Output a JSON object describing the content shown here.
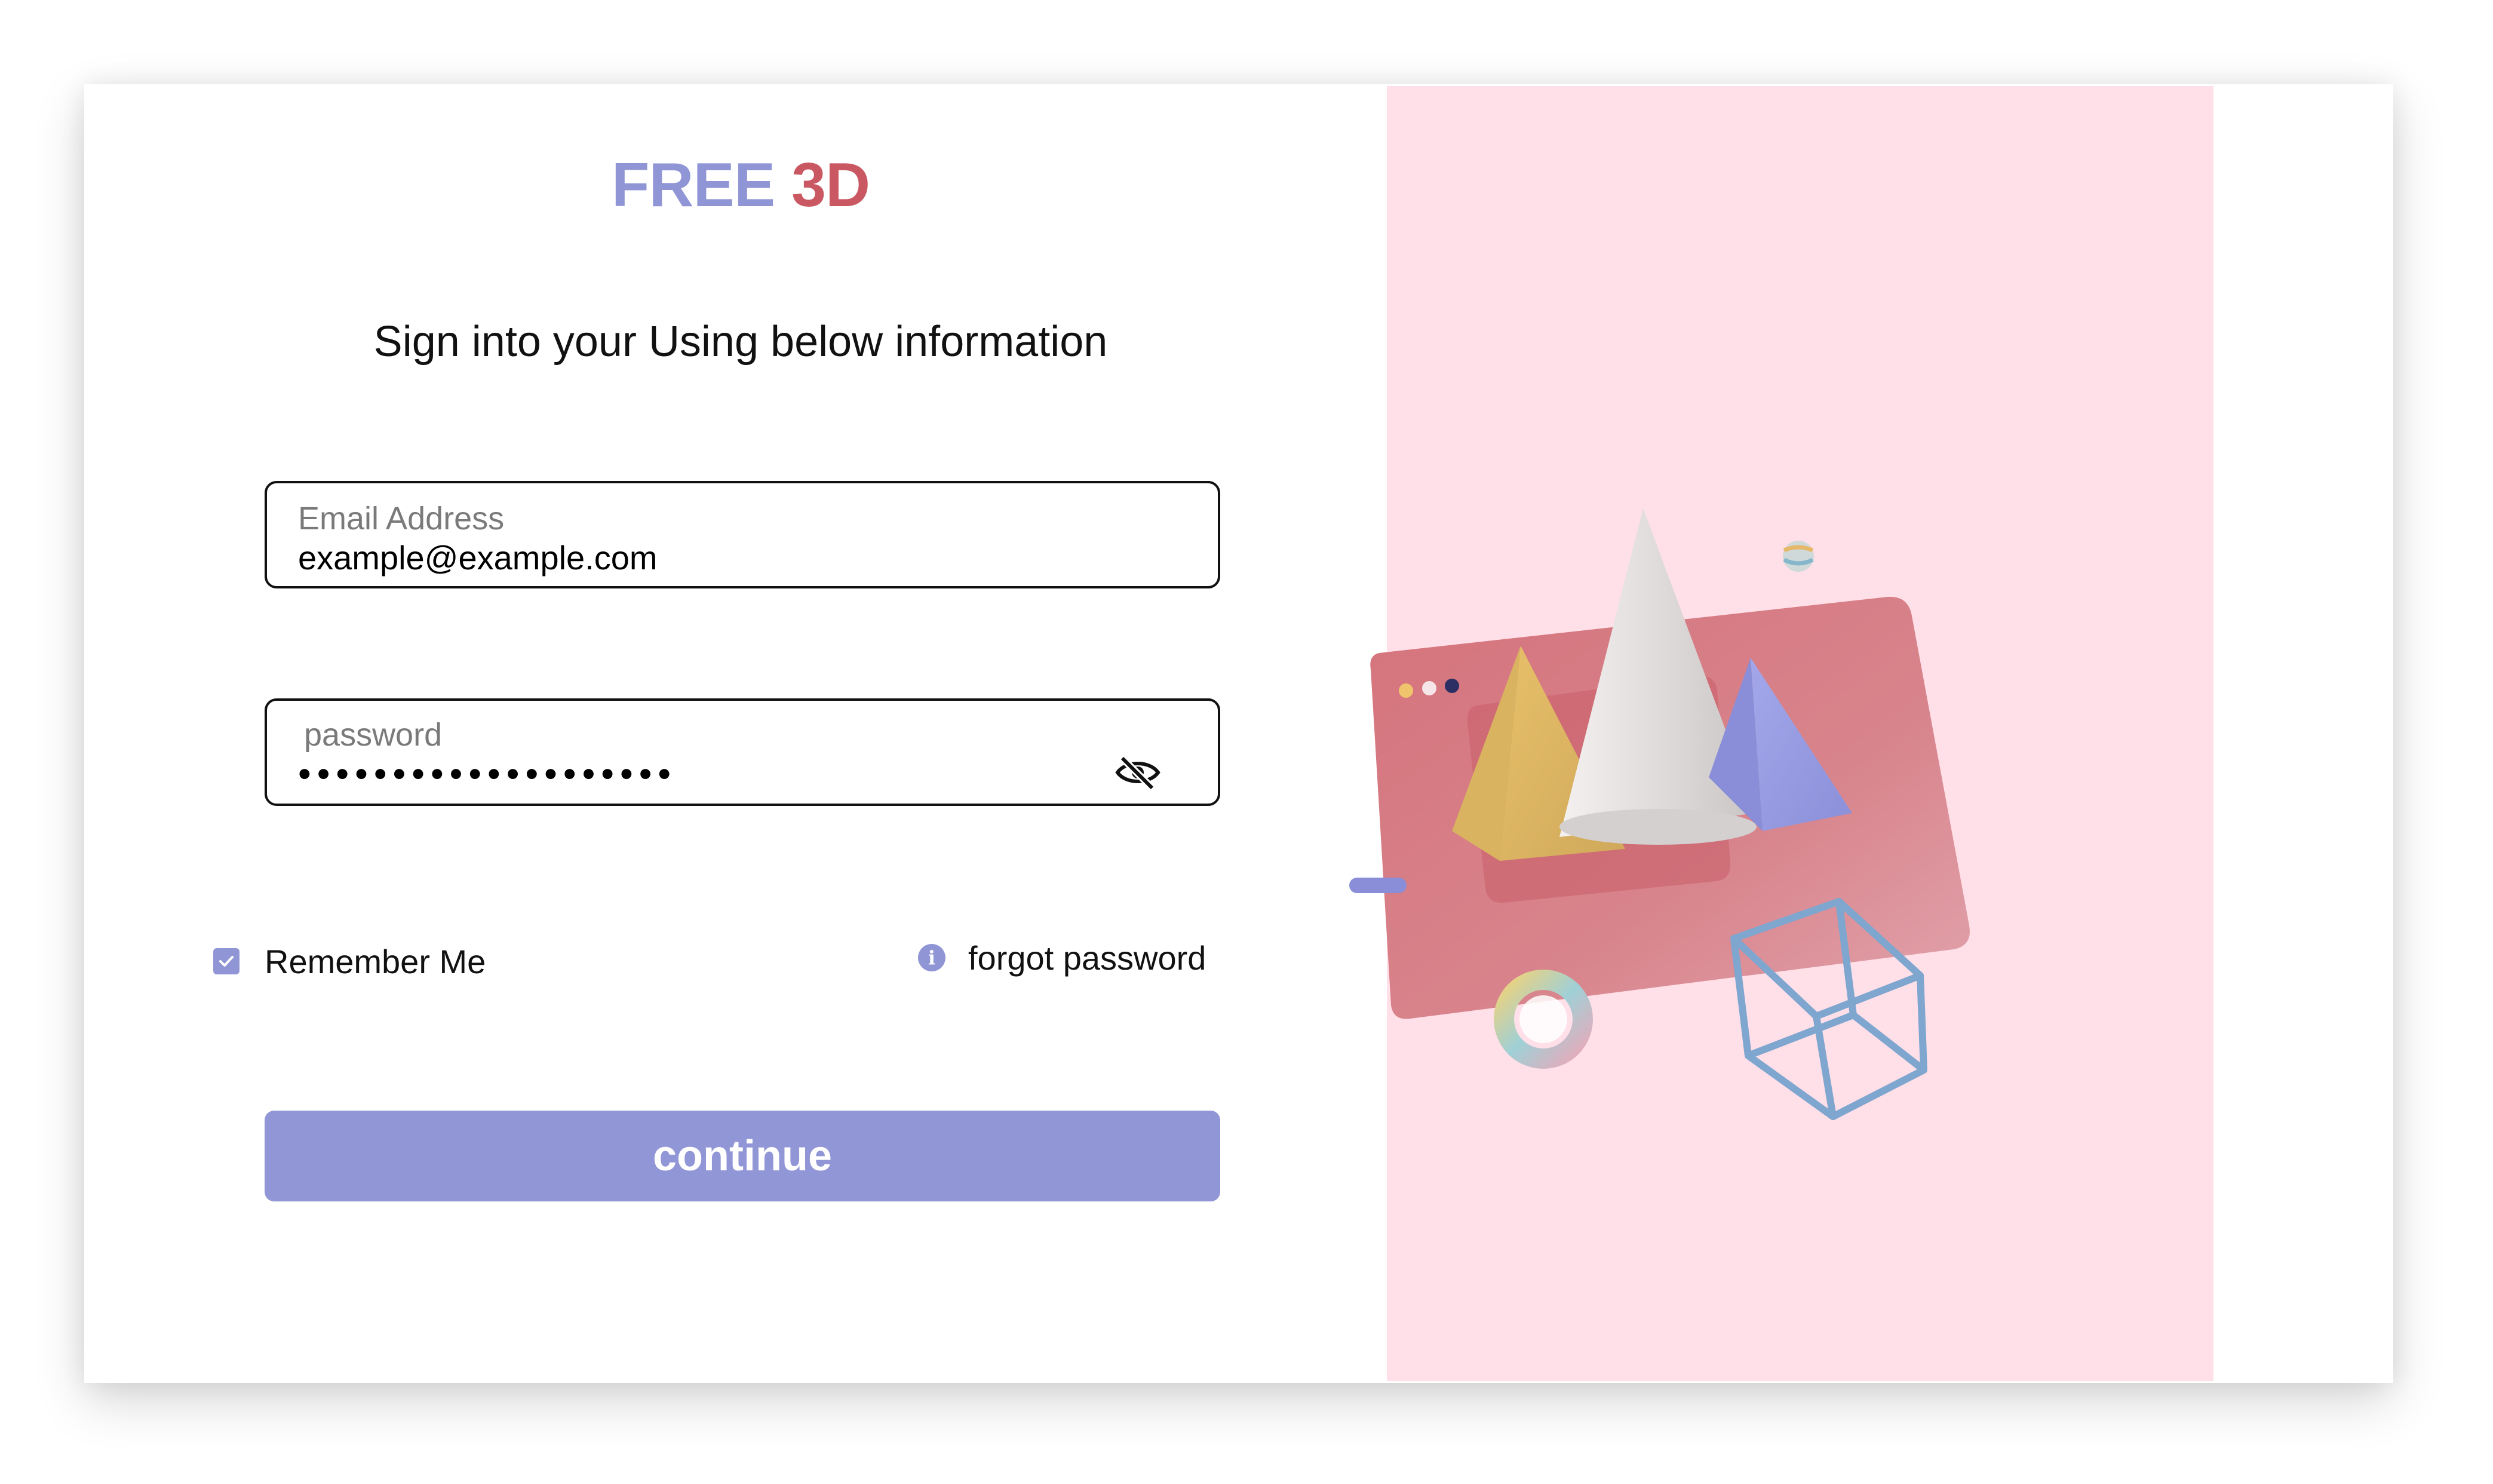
{
  "brand": {
    "word1": "FREE",
    "word2": "3D",
    "color1": "#9095d6",
    "color2": "#c95862"
  },
  "subtitle": "Sign into your Using below information",
  "email": {
    "label": "Email Address",
    "value": "example@example.com"
  },
  "password": {
    "label": "password",
    "value": "••••••••••••••••••••",
    "toggle_icon": "eye-off-icon"
  },
  "remember": {
    "label": "Remember Me",
    "checked": true
  },
  "forgot": {
    "label": "forgot password",
    "icon": "info-icon"
  },
  "continue_label": "continue",
  "colors": {
    "accent": "#9196d6",
    "panel": "#ffdfe8",
    "brand_red": "#c95862"
  }
}
